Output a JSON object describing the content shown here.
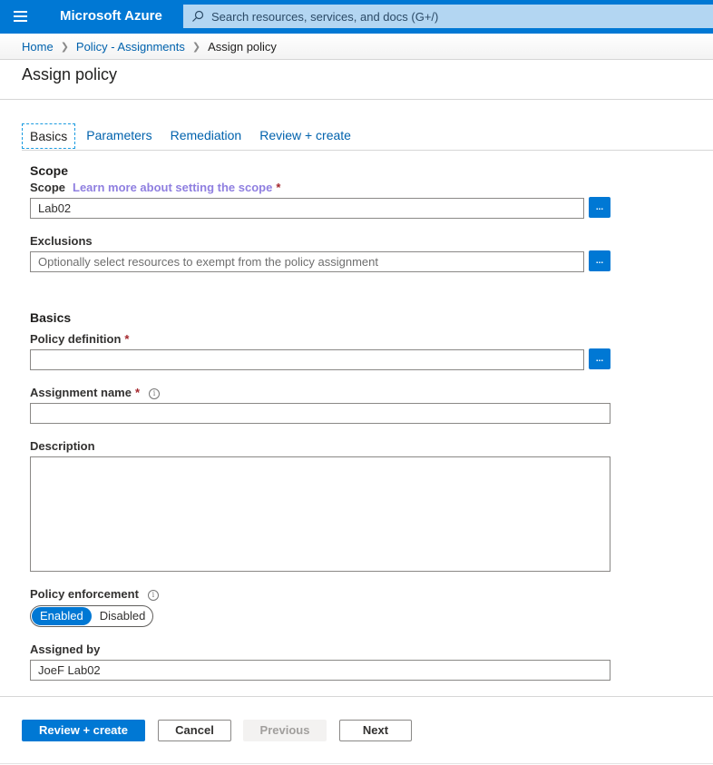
{
  "header": {
    "brand": "Microsoft Azure",
    "search_placeholder": "Search resources, services, and docs (G+/)",
    "menu_icon": "hamburger-menu-icon",
    "search_icon": "search-icon"
  },
  "breadcrumb": [
    {
      "label": "Home",
      "link": true
    },
    {
      "label": "Policy - Assignments",
      "link": true
    },
    {
      "label": "Assign policy",
      "link": false
    }
  ],
  "page_title": "Assign policy",
  "tabs": [
    {
      "label": "Basics",
      "active": true
    },
    {
      "label": "Parameters",
      "active": false
    },
    {
      "label": "Remediation",
      "active": false
    },
    {
      "label": "Review + create",
      "active": false
    }
  ],
  "scope_section": {
    "heading": "Scope",
    "scope_label": "Scope",
    "scope_link": "Learn more about setting the scope",
    "required_mark": "*",
    "scope_value": "Lab02",
    "exclusions_label": "Exclusions",
    "exclusions_placeholder": "Optionally select resources to exempt from the policy assignment",
    "browse_button": "..."
  },
  "basics_section": {
    "heading": "Basics",
    "policy_definition_label": "Policy definition",
    "policy_definition_value": "",
    "assignment_name_label": "Assignment name",
    "assignment_name_value": "",
    "description_label": "Description",
    "description_value": "",
    "policy_enforcement_label": "Policy enforcement",
    "enforcement_options": [
      "Enabled",
      "Disabled"
    ],
    "enforcement_selected": "Enabled",
    "assigned_by_label": "Assigned by",
    "assigned_by_value": "JoeF Lab02",
    "info_icon": "i"
  },
  "footer": {
    "review_create": "Review + create",
    "cancel": "Cancel",
    "previous": "Previous",
    "next": "Next"
  },
  "colors": {
    "brand_blue": "#0078d4",
    "link_blue": "#0062ad",
    "required_red": "#a4262c",
    "learn_link_purple": "#8f7fe0"
  }
}
